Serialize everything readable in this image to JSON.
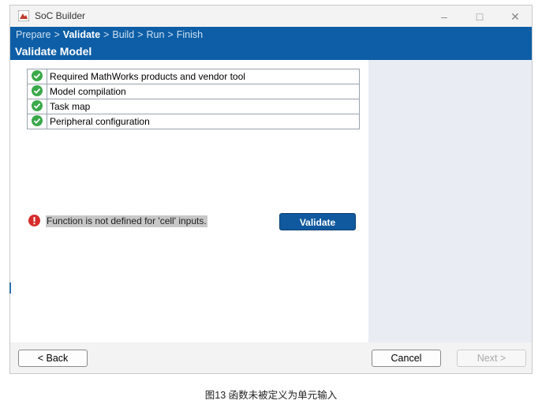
{
  "window": {
    "title": "SoC Builder"
  },
  "steps": {
    "prepare": "Prepare",
    "validate": "Validate",
    "build": "Build",
    "run": "Run",
    "finish": "Finish",
    "separator": ">"
  },
  "page_title": "Validate Model",
  "checks": [
    {
      "label": "Required MathWorks products and vendor tool",
      "status": "success",
      "icon": "check-circle-icon"
    },
    {
      "label": "Model compilation",
      "status": "success",
      "icon": "check-circle-icon"
    },
    {
      "label": "Task map",
      "status": "success",
      "icon": "check-circle-icon"
    },
    {
      "label": "Peripheral configuration",
      "status": "success",
      "icon": "check-circle-icon"
    }
  ],
  "error": {
    "message": "Function is not defined for 'cell' inputs.",
    "icon": "error-icon"
  },
  "validate_button": "Validate",
  "footer": {
    "back": "< Back",
    "cancel": "Cancel",
    "next": "Next >"
  },
  "caption": "图13 函数未被定义为单元输入",
  "colors": {
    "header": "#0d5ea6",
    "success": "#3aa94a",
    "error": "#d62b2b",
    "primary_button": "#10599e"
  }
}
